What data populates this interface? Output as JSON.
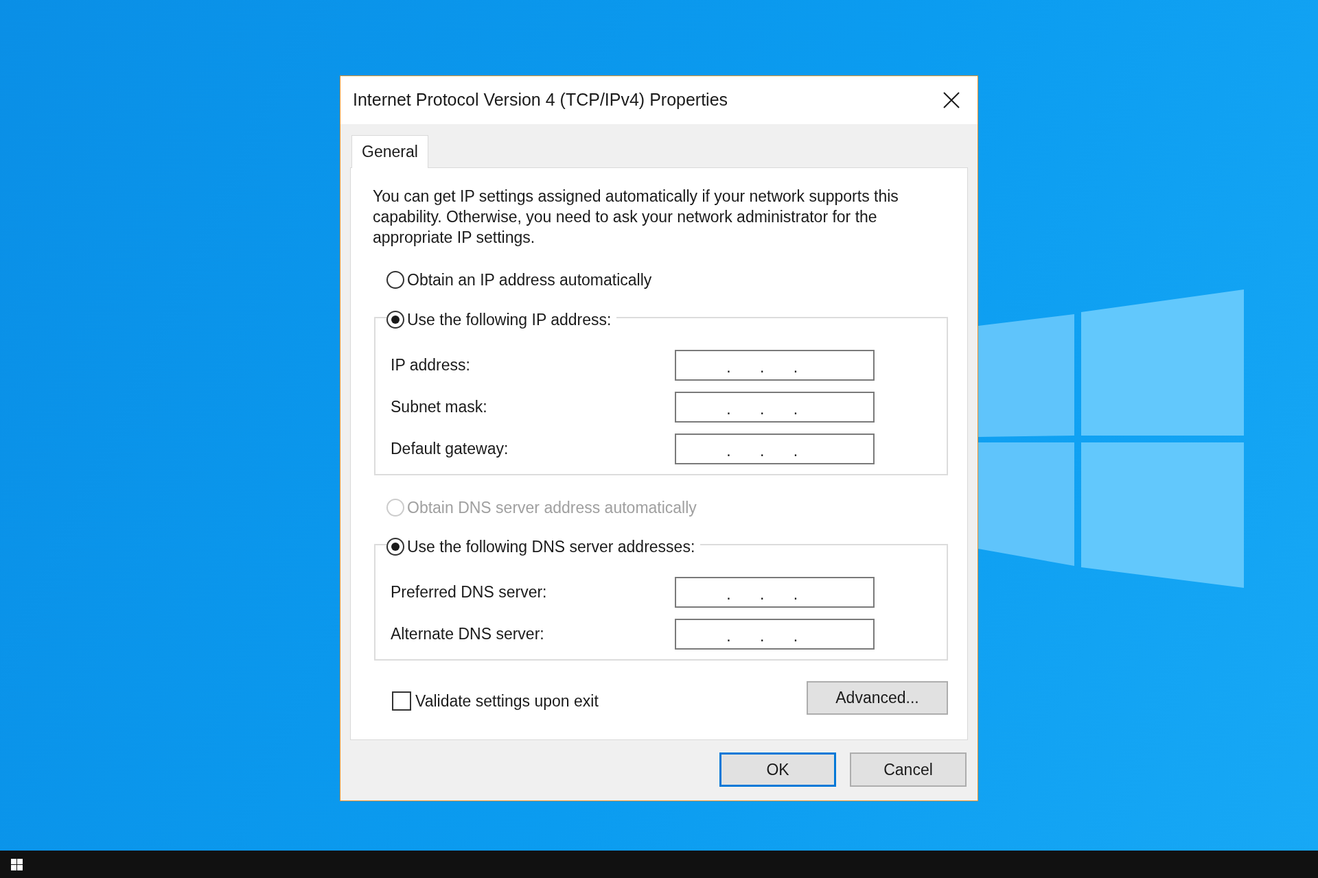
{
  "window": {
    "title": "Internet Protocol Version 4 (TCP/IPv4) Properties"
  },
  "tabs": [
    {
      "label": "General",
      "selected": true
    }
  ],
  "description": "You can get IP settings assigned automatically if your network supports this capability. Otherwise, you need to ask your network administrator for the appropriate IP settings.",
  "ip_options": [
    {
      "label": "Obtain an IP address automatically",
      "selected": false,
      "disabled": false
    },
    {
      "label": "Use the following IP address:",
      "selected": true,
      "disabled": false
    }
  ],
  "ip_fields": [
    {
      "label": "IP address:",
      "separators": [
        ".",
        ".",
        "."
      ]
    },
    {
      "label": "Subnet mask:",
      "separators": [
        ".",
        ".",
        "."
      ]
    },
    {
      "label": "Default gateway:",
      "separators": [
        ".",
        ".",
        "."
      ]
    }
  ],
  "dns_options": [
    {
      "label": "Obtain DNS server address automatically",
      "selected": false,
      "disabled": true
    },
    {
      "label": "Use the following DNS server addresses:",
      "selected": true,
      "disabled": false
    }
  ],
  "dns_fields": [
    {
      "label": "Preferred DNS server:",
      "separators": [
        ".",
        ".",
        "."
      ]
    },
    {
      "label": "Alternate DNS server:",
      "separators": [
        ".",
        ".",
        "."
      ]
    }
  ],
  "validate_checkbox": {
    "label": "Validate settings upon exit",
    "checked": false
  },
  "advanced_button": {
    "label": "Advanced..."
  },
  "buttons": [
    {
      "label": "OK",
      "default": true
    },
    {
      "label": "Cancel",
      "default": false
    }
  ]
}
